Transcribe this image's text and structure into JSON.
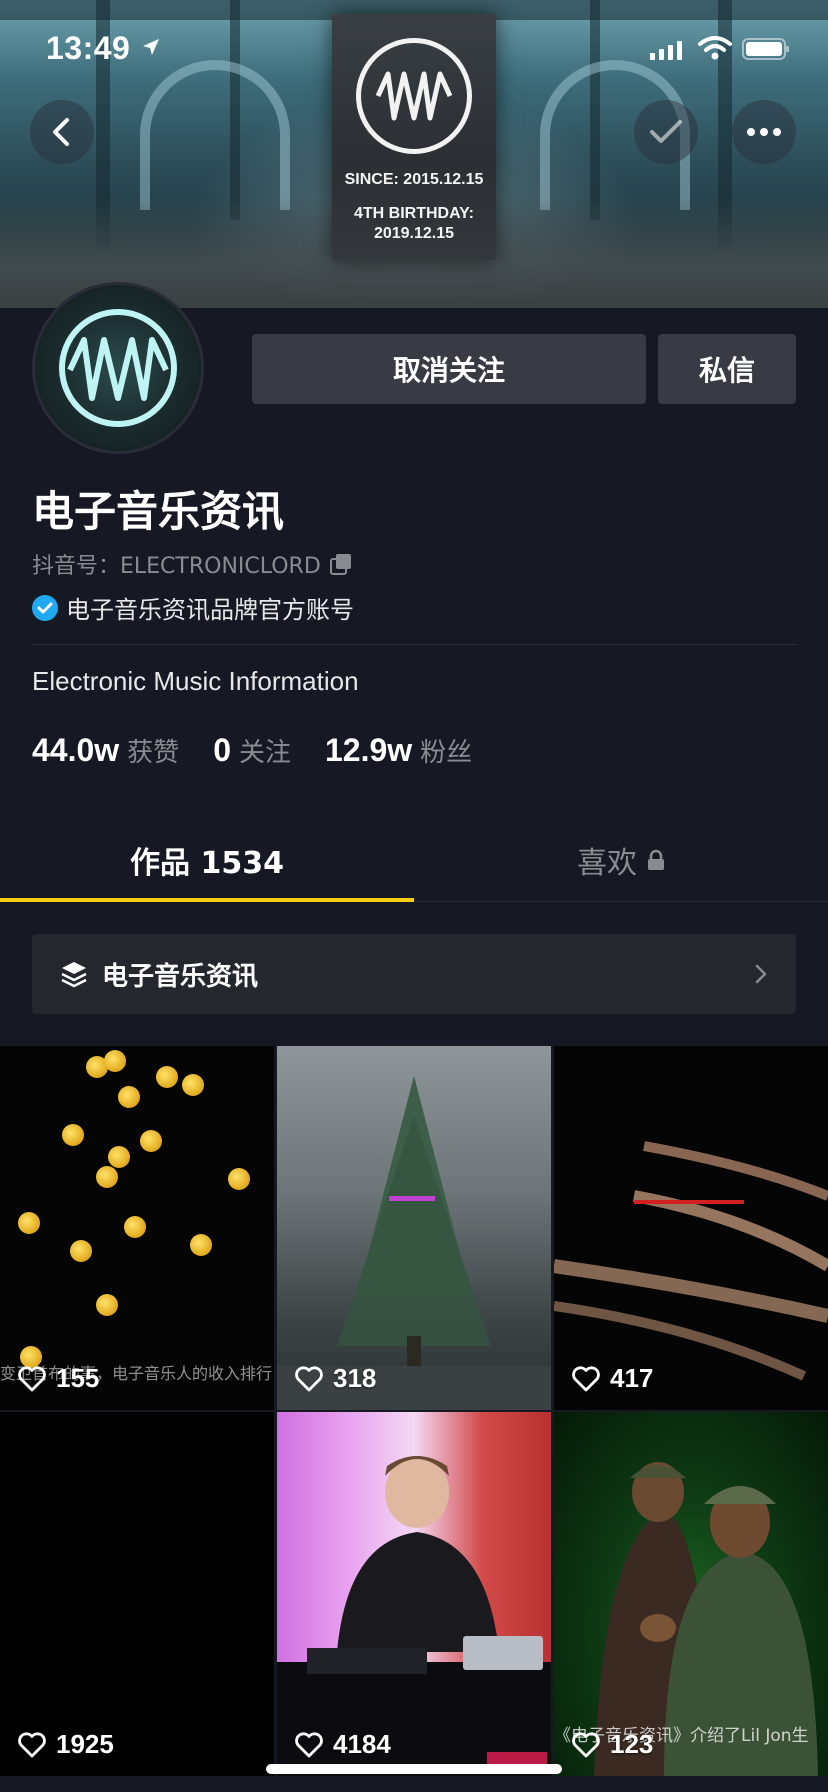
{
  "status_bar": {
    "time": "13:49"
  },
  "banner": {
    "poster_line1": "SINCE: 2015.12.15",
    "poster_line2": "4TH BIRTHDAY:",
    "poster_line3": "2019.12.15"
  },
  "actions": {
    "unfollow_label": "取消关注",
    "message_label": "私信"
  },
  "profile": {
    "name": "电子音乐资讯",
    "douyin_id": "抖音号：ELECTRONICLORD",
    "verification": "电子音乐资讯品牌官方账号",
    "bio": "Electronic Music Information"
  },
  "stats": [
    {
      "value": "44.0w",
      "label": "获赞"
    },
    {
      "value": "0",
      "label": "关注"
    },
    {
      "value": "12.9w",
      "label": "粉丝"
    }
  ],
  "tabs": {
    "works": "作品 1534",
    "likes": "喜欢"
  },
  "collection": {
    "label": "电子音乐资讯"
  },
  "videos": [
    {
      "likes": "155",
      "caption": "变卫首布的事，电子音乐人的收入排行"
    },
    {
      "likes": "318"
    },
    {
      "likes": "417"
    },
    {
      "likes": "1925"
    },
    {
      "likes": "4184"
    },
    {
      "likes": "123",
      "caption": "《电子音乐资讯》介绍了Lil Jon生"
    }
  ],
  "colors": {
    "background": "#161823",
    "accent": "#face15",
    "button": "#393b44",
    "verified": "#20a8f0"
  }
}
